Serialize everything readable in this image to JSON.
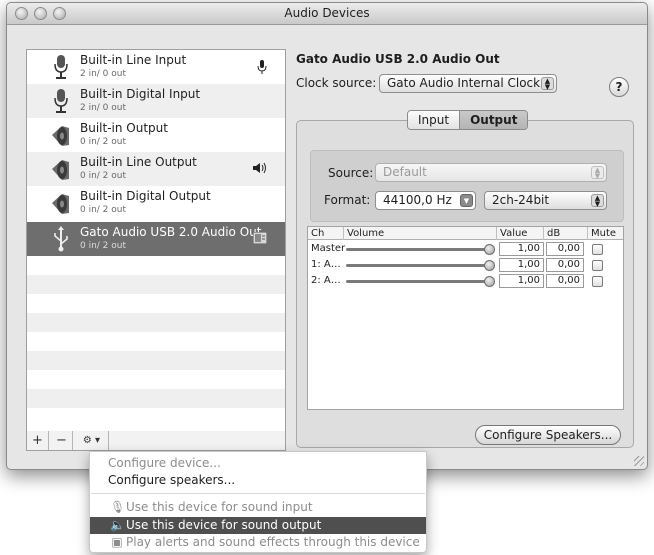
{
  "window": {
    "title": "Audio Devices"
  },
  "devices": [
    {
      "name": "Built-in Line Input",
      "io": "2 in/ 0 out",
      "icon": "microphone-icon",
      "role_icon": "mic-input-icon"
    },
    {
      "name": "Built-in Digital Input",
      "io": "2 in/ 0 out",
      "icon": "microphone-icon",
      "role_icon": ""
    },
    {
      "name": "Built-in Output",
      "io": "0 in/ 2 out",
      "icon": "speaker-icon",
      "role_icon": ""
    },
    {
      "name": "Built-in Line Output",
      "io": "0 in/ 2 out",
      "icon": "speaker-icon",
      "role_icon": "speaker-output-icon"
    },
    {
      "name": "Built-in Digital Output",
      "io": "0 in/ 2 out",
      "icon": "speaker-icon",
      "role_icon": ""
    },
    {
      "name": "Gato Audio USB 2.0 Audio Out",
      "io": "0 in/ 2 out",
      "icon": "usb-icon",
      "role_icon": "alert-icon",
      "selected": true
    }
  ],
  "toolbar": {
    "add": "+",
    "remove": "−",
    "action": "⚙ ▾"
  },
  "detail": {
    "device_title": "Gato Audio USB 2.0 Audio Out",
    "clock_label": "Clock source:",
    "clock_value": "Gato Audio Internal Clock",
    "help": "?",
    "tabs": [
      "Input",
      "Output"
    ],
    "active_tab": "Output",
    "source_label": "Source:",
    "source_value": "Default",
    "format_label": "Format:",
    "format_rate": "44100,0 Hz",
    "format_bits": "2ch-24bit",
    "configure_speakers": "Configure Speakers..."
  },
  "table": {
    "headers": [
      "Ch",
      "Volume",
      "Value",
      "dB",
      "Mute"
    ],
    "rows": [
      {
        "ch": "Master",
        "volume": 1.0,
        "value": "1,00",
        "db": "0,00",
        "mute": false
      },
      {
        "ch": "1: A…",
        "volume": 1.0,
        "value": "1,00",
        "db": "0,00",
        "mute": false
      },
      {
        "ch": "2: A…",
        "volume": 1.0,
        "value": "1,00",
        "db": "0,00",
        "mute": false
      }
    ]
  },
  "menu": {
    "items": [
      {
        "label": "Configure device...",
        "disabled": true
      },
      {
        "label": "Configure speakers...",
        "disabled": false
      },
      {
        "label": "Use this device for sound input",
        "disabled": true,
        "icon": "microphone-icon"
      },
      {
        "label": "Use this device for sound output",
        "highlighted": true,
        "icon": "speaker-icon"
      },
      {
        "label": "Play alerts and sound effects through this device",
        "disabled": true,
        "icon": "alert-icon"
      }
    ]
  }
}
